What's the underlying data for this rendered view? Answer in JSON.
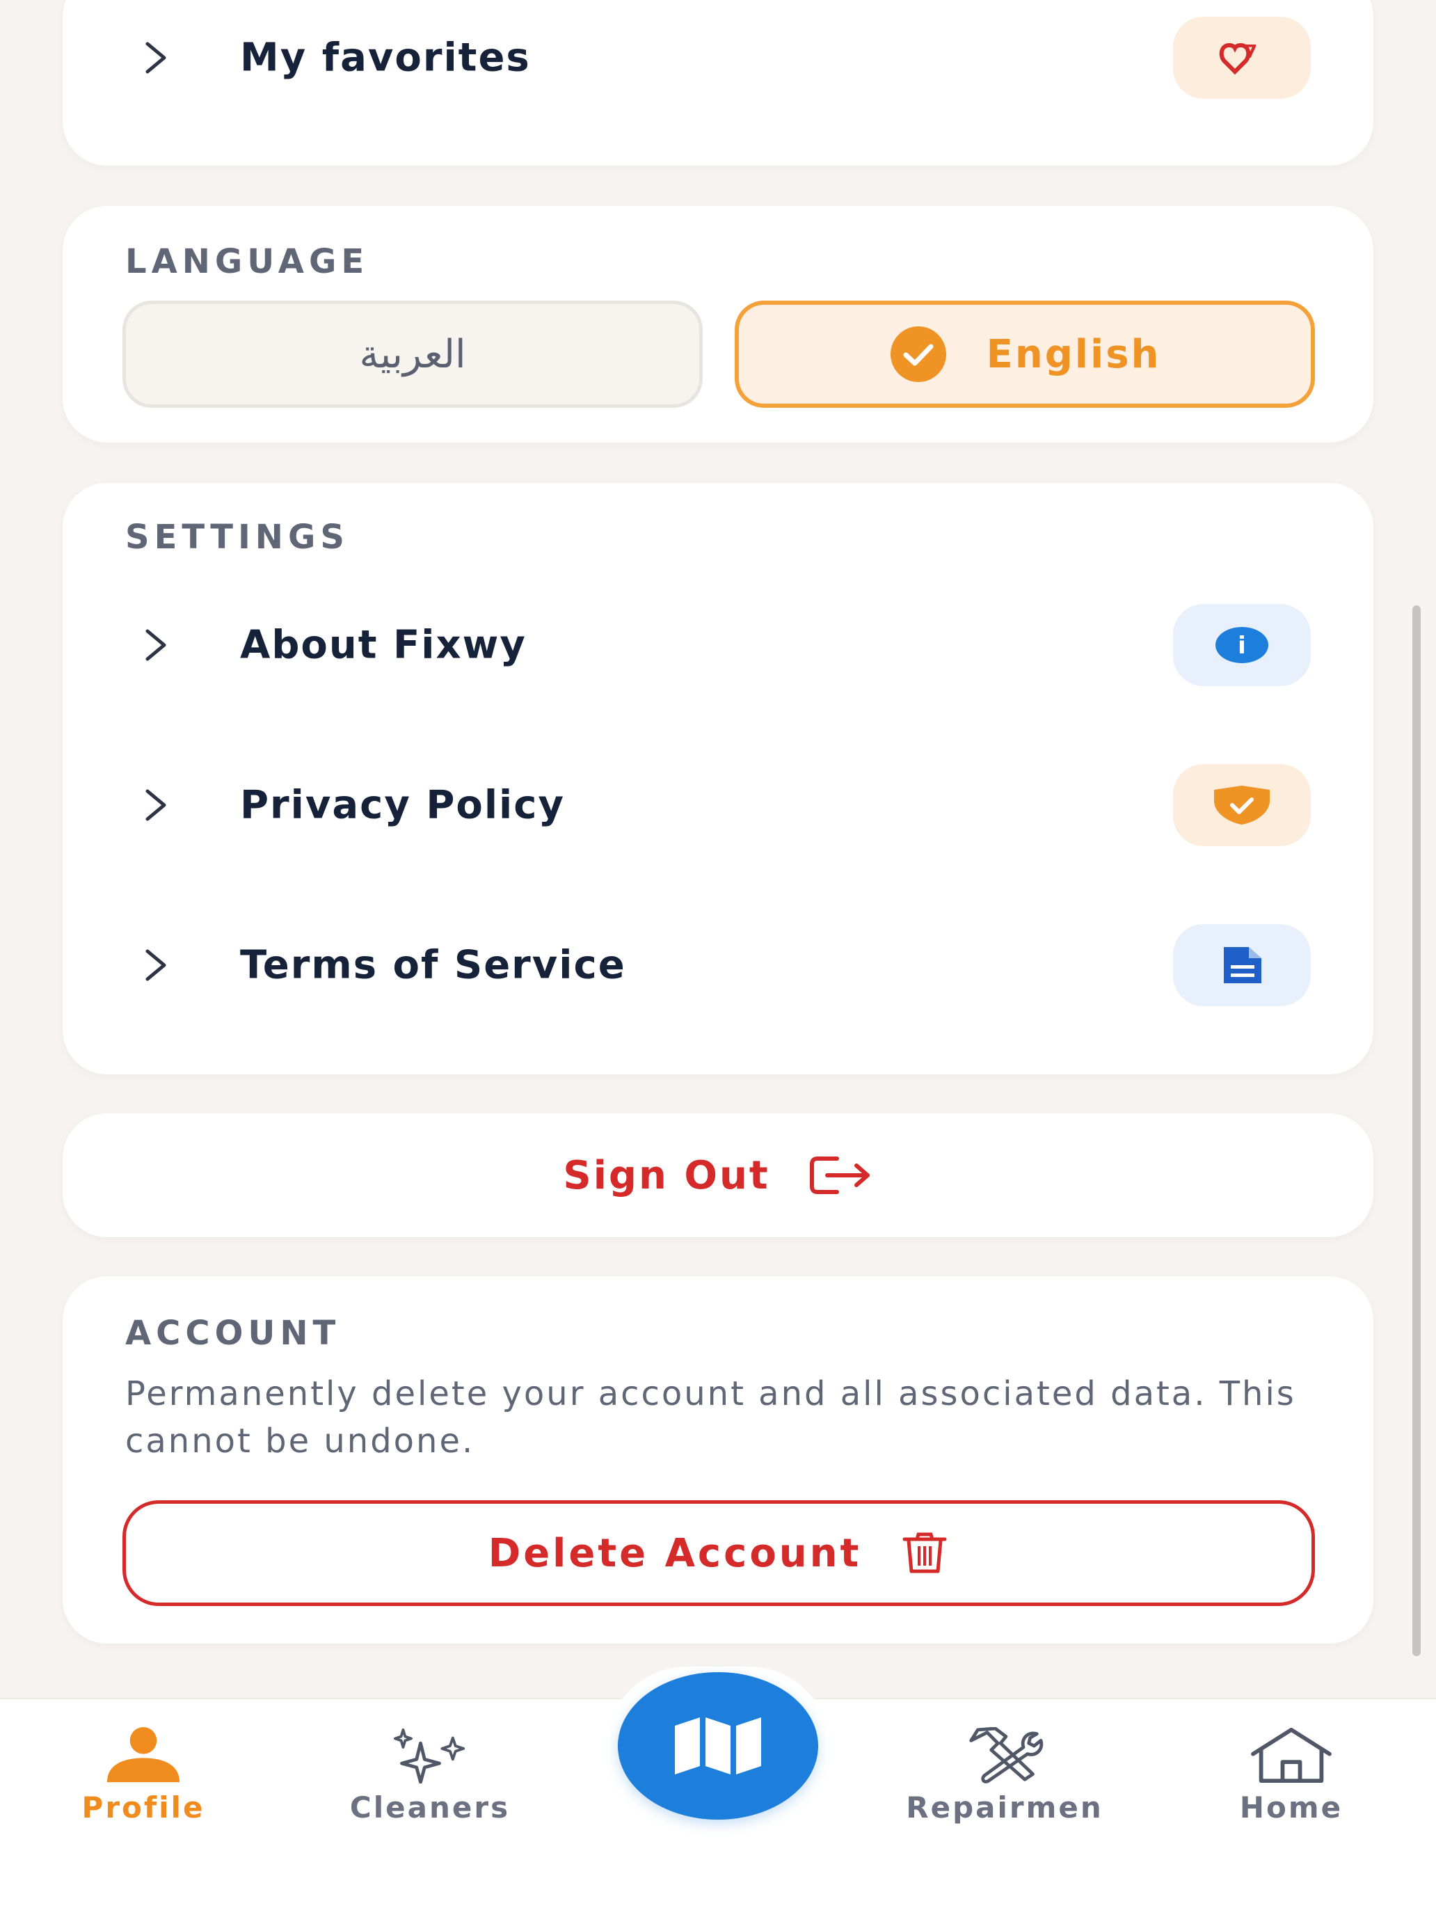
{
  "favorites_card": {
    "item_label": "My favorites",
    "icon": "heart-badge-icon"
  },
  "language": {
    "title": "LANGUAGE",
    "options": [
      {
        "label": "العربية",
        "selected": false
      },
      {
        "label": "English",
        "selected": true
      }
    ]
  },
  "settings": {
    "title": "SETTINGS",
    "items": [
      {
        "label": "About Fixwy",
        "icon": "info-icon"
      },
      {
        "label": "Privacy Policy",
        "icon": "shield-check-icon"
      },
      {
        "label": "Terms of Service",
        "icon": "document-icon"
      }
    ]
  },
  "sign_out": {
    "label": "Sign Out",
    "icon": "logout-icon"
  },
  "account": {
    "title": "ACCOUNT",
    "description": "Permanently delete your account and all associated data. This cannot be undone.",
    "delete_label": "Delete Account",
    "delete_icon": "trash-icon"
  },
  "bottom_nav": {
    "items": [
      {
        "label": "Profile",
        "icon": "user-icon",
        "active": true
      },
      {
        "label": "Cleaners",
        "icon": "sparkles-icon",
        "active": false
      },
      {
        "label": "Repairmen",
        "icon": "tools-icon",
        "active": false
      },
      {
        "label": "Home",
        "icon": "home-icon",
        "active": false
      }
    ],
    "center_button_icon": "map-icon"
  },
  "colors": {
    "accent_orange": "#f08c1e",
    "danger_red": "#d42a2a",
    "primary_blue": "#1d7fdb",
    "text_dark": "#16213a",
    "muted": "#5f6675",
    "background": "#f6f3f0"
  }
}
